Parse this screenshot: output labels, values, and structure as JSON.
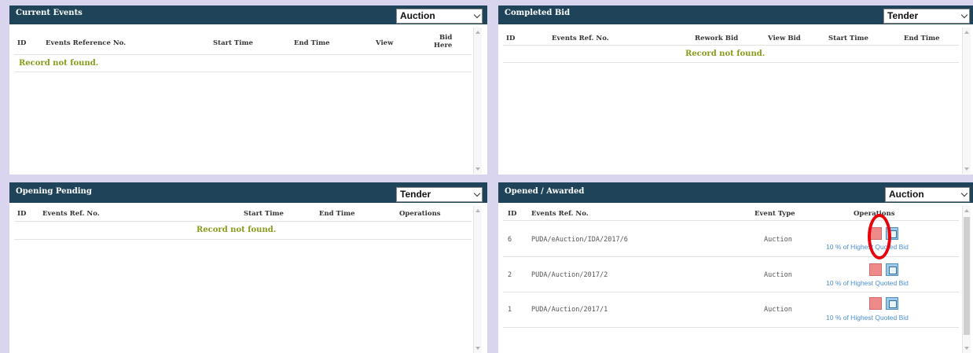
{
  "current_events": {
    "title": "Current Events",
    "select_value": "Auction",
    "columns": [
      "ID",
      "Events Reference No.",
      "Start Time",
      "End Time",
      "View",
      "Bid\nHere"
    ],
    "empty_message": "Record not found."
  },
  "completed_bid": {
    "title": "Completed Bid",
    "select_value": "Tender",
    "columns": [
      "ID",
      "Events Ref. No.",
      "Rework Bid",
      "View Bid",
      "Start Time",
      "End Time"
    ],
    "empty_message": "Record not found."
  },
  "opening_pending": {
    "title": "Opening Pending",
    "select_value": "Tender",
    "columns": [
      "ID",
      "Events Ref. No.",
      "Start Time",
      "End Time",
      "Operations"
    ],
    "empty_message": "Record not found."
  },
  "opened_awarded": {
    "title": "Opened / Awarded",
    "select_value": "Auction",
    "columns": [
      "ID",
      "Events Ref. No.",
      "Event Type",
      "Operations"
    ],
    "rows": [
      {
        "id": "6",
        "ref": "PUDA/eAuction/IDA/2017/6",
        "type": "Auction",
        "link": "10 % of Highest Quoted Bid"
      },
      {
        "id": "2",
        "ref": "PUDA/Auction/2017/2",
        "type": "Auction",
        "link": "10 % of Highest Quoted Bid"
      },
      {
        "id": "1",
        "ref": "PUDA/Auction/2017/1",
        "type": "Auction",
        "link": "10 % of Highest Quoted Bid"
      }
    ]
  },
  "icons": {
    "scroll_up": "chevron-up-icon",
    "scroll_down": "chevron-down-icon",
    "delete": "delete-icon",
    "view_document": "document-icon"
  },
  "colors": {
    "header_bg": "#1f4459",
    "empty_text": "#8a9a1a",
    "link": "#4b8fd0",
    "annotation_circle": "#e8000b"
  }
}
